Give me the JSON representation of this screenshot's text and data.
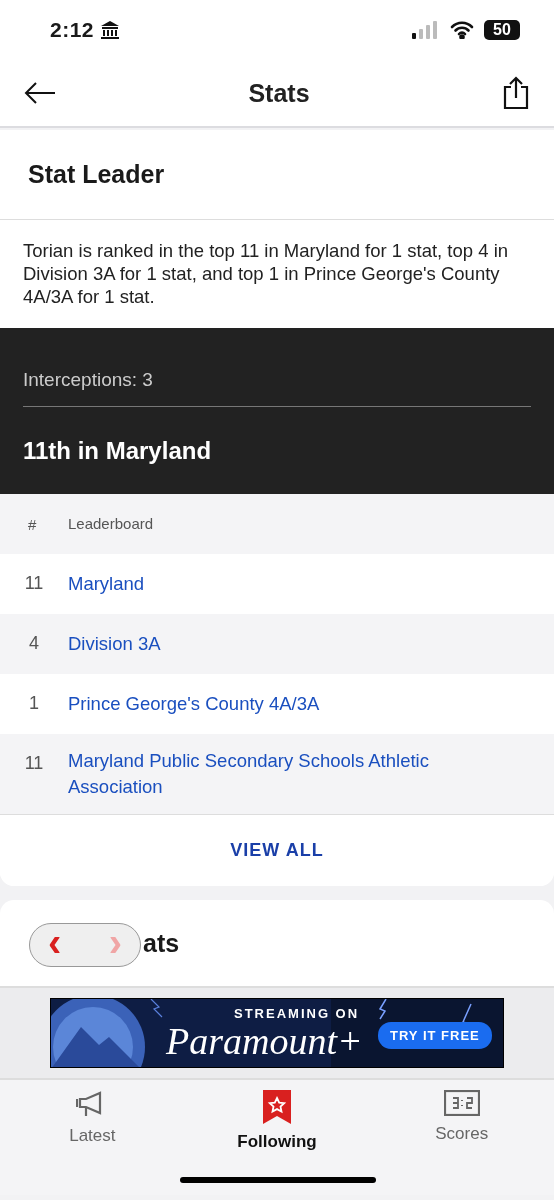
{
  "status_bar": {
    "time": "2:12",
    "battery": "50"
  },
  "nav": {
    "title": "Stats"
  },
  "stat_leader": {
    "title": "Stat Leader",
    "summary": "Torian is ranked in the top 11 in Maryland for 1 stat, top 4 in Division 3A for 1 stat, and top 1 in Prince George's County 4A/3A for 1 stat.",
    "stat": "Interceptions: 3",
    "rank": "11th in Maryland",
    "columns": [
      "#",
      "Leaderboard"
    ],
    "rows": [
      {
        "rank": "11",
        "board": "Maryland"
      },
      {
        "rank": "4",
        "board": "Division 3A"
      },
      {
        "rank": "1",
        "board": "Prince George's County 4A/3A"
      },
      {
        "rank": "11",
        "board": "Maryland Public Secondary Schools Athletic Association"
      }
    ],
    "view_all": "VIEW ALL"
  },
  "quick_stats": {
    "title": "ats",
    "prev": "‹",
    "next": "›"
  },
  "ad": {
    "eyebrow": "STREAMING ON",
    "brand": "Paramount+",
    "cta": "TRY IT FREE"
  },
  "tabs": [
    {
      "label": "Latest",
      "kind": "megaphone",
      "selected": false
    },
    {
      "label": "Following",
      "kind": "bookmark",
      "selected": true
    },
    {
      "label": "Scores",
      "kind": "scoreboard",
      "selected": false
    }
  ]
}
